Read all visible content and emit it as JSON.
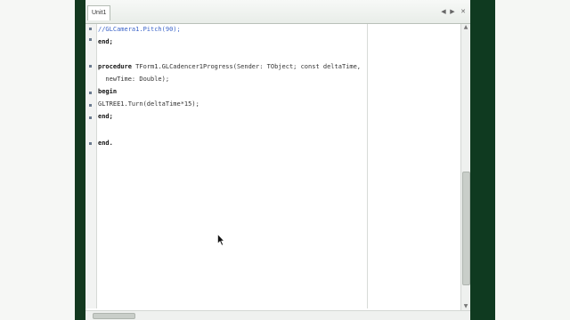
{
  "tab": {
    "label": "Unit1"
  },
  "toolbar": {
    "nav_icon": "nav-back-forward-icon",
    "close_icon": "close-icon"
  },
  "code_lines": [
    {
      "text": "//GLCamera1.Pitch(90);",
      "kind": "comment"
    },
    {
      "text": "end;",
      "kind": "keyword"
    },
    {
      "text": "",
      "kind": "plain"
    },
    {
      "text": "procedure TForm1.GLCadencer1Progress(Sender: TObject; const deltaTime,",
      "kind": "proc"
    },
    {
      "text": "  newTime: Double);",
      "kind": "plain"
    },
    {
      "text": "begin",
      "kind": "keyword"
    },
    {
      "text": "GLTREE1.Turn(deltaTime*15);",
      "kind": "plain"
    },
    {
      "text": "end;",
      "kind": "keyword"
    },
    {
      "text": "",
      "kind": "plain"
    },
    {
      "text": "end.",
      "kind": "keyword"
    }
  ],
  "icons": {
    "cursor": "mouse-pointer-icon",
    "gutter_marker": "breakpoint-dot-icon"
  }
}
